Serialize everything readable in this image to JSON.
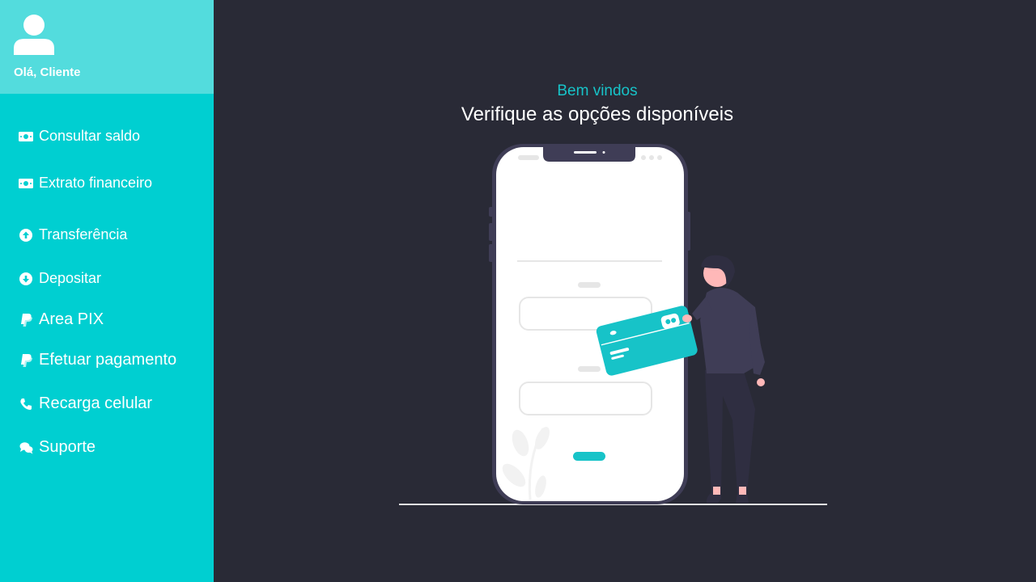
{
  "sidebar": {
    "greeting": "Olá, Cliente",
    "items": [
      {
        "label": "Consultar saldo",
        "icon": "money-bill-icon"
      },
      {
        "label": "Extrato financeiro",
        "icon": "money-bill-icon"
      },
      {
        "label": "Transferência",
        "icon": "arrow-up-circle-icon"
      },
      {
        "label": "Depositar",
        "icon": "arrow-down-circle-icon"
      },
      {
        "label": "Area PIX",
        "icon": "paypal-icon"
      },
      {
        "label": "Efetuar pagamento",
        "icon": "paypal-icon"
      },
      {
        "label": "Recarga celular",
        "icon": "phone-icon"
      },
      {
        "label": "Suporte",
        "icon": "chat-bubbles-icon"
      }
    ]
  },
  "main": {
    "welcome": "Bem vindos",
    "subtitle": "Verifique as opções disponíveis"
  },
  "colors": {
    "sidebar": "#00cfd1",
    "sidebar_header": "#53dcdd",
    "background": "#292a36",
    "accent": "#17c3c8",
    "text": "#ffffff"
  }
}
